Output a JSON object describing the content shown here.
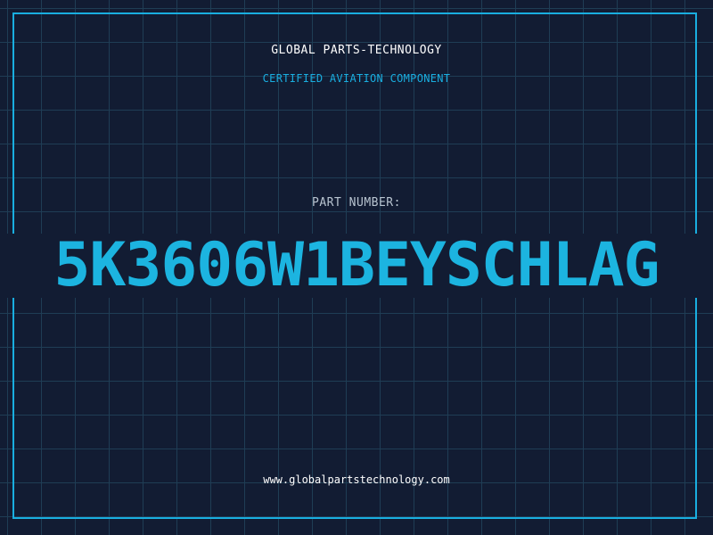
{
  "header": {
    "company_name": "GLOBAL PARTS-TECHNOLOGY",
    "tagline": "CERTIFIED AVIATION COMPONENT"
  },
  "part": {
    "label": "PART NUMBER:",
    "number": "5K3606W1BEYSCHLAG"
  },
  "footer": {
    "website": "www.globalpartstechnology.com"
  },
  "colors": {
    "background": "#121c33",
    "grid": "#1f3d55",
    "accent": "#19aee0",
    "text": "#ffffff"
  }
}
